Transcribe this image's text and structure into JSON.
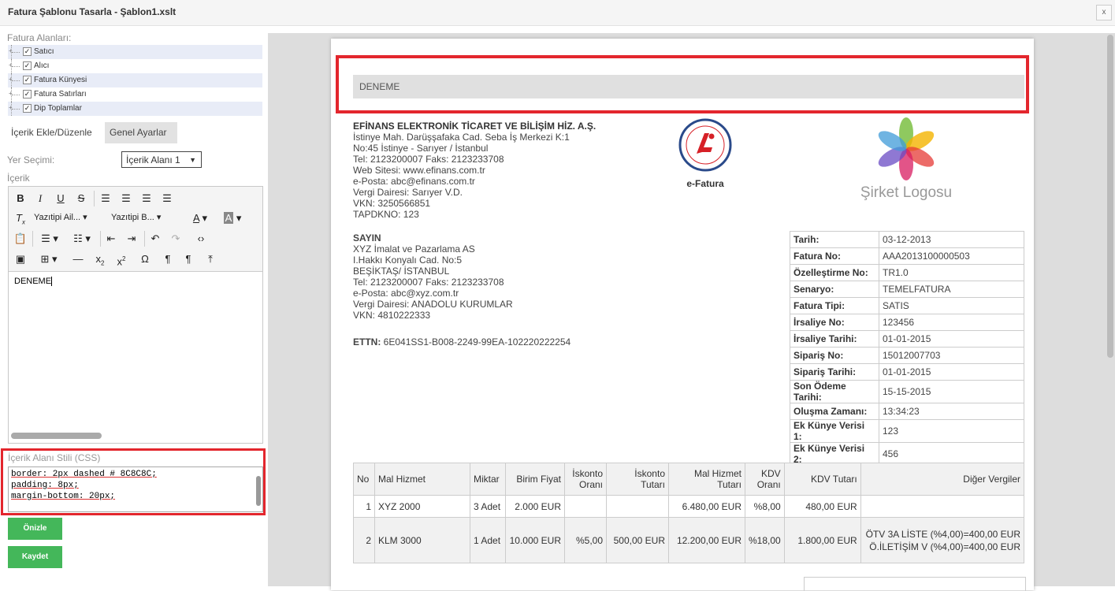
{
  "window": {
    "title": "Fatura Şablonu Tasarla - Şablon1.xslt",
    "close_label": "x"
  },
  "left": {
    "fields_label": "Fatura Alanları:",
    "tree": [
      "Satıcı",
      "Alıcı",
      "Fatura Künyesi",
      "Fatura Satırları",
      "Dip Toplamlar"
    ],
    "tabs": [
      "İçerik Ekle/Düzenle",
      "Genel Ayarlar"
    ],
    "location_label": "Yer Seçimi:",
    "location_value": "İçerik Alanı 1",
    "content_label": "İçerik",
    "font_family_dd": "Yazıtipi Ail...",
    "font_size_dd": "Yazıtipi B...",
    "editor_text": "DENEME",
    "css_label": "İçerik Alanı Stili (CSS)",
    "css_lines": [
      "border: 2px dashed # 8C8C8C;",
      "padding: 8px;",
      "margin-bottom: 20px;"
    ],
    "preview_btn": "Önizle",
    "save_btn": "Kaydet"
  },
  "invoice": {
    "header_text": "DENEME",
    "seller": {
      "name": "EFİNANS ELEKTRONİK TİCARET VE BİLİŞİM HİZ. A.Ş.",
      "lines": [
        "İstinye Mah. Darüşşafaka Cad. Seba İş Merkezi K:1",
        "No:45 İstinye - Sarıyer / İstanbul",
        "Tel: 2123200007 Faks: 2123233708",
        "Web Sitesi: www.efinans.com.tr",
        "e-Posta: abc@efinans.com.tr",
        "Vergi Dairesi: Sarıyer V.D.",
        "VKN: 3250566851",
        "TAPDKNO: 123"
      ]
    },
    "efatura_label": "e-Fatura",
    "company_logo": "Şirket Logosu",
    "buyer": {
      "title": "SAYIN",
      "lines": [
        "XYZ İmalat ve Pazarlama AS",
        "I.Hakkı Konyalı Cad.  No:5",
        "BEŞİKTAŞ/ İSTANBUL",
        "Tel: 2123200007 Faks: 2123233708",
        "e-Posta: abc@xyz.com.tr",
        "Vergi Dairesi: ANADOLU KURUMLAR",
        "VKN: 4810222333"
      ]
    },
    "ettn_label": "ETTN:",
    "ettn_value": "6E041SS1-B008-2249-99EA-102220222254",
    "info": [
      [
        "Tarih:",
        "03-12-2013"
      ],
      [
        "Fatura No:",
        "AAA2013100000503"
      ],
      [
        "Özelleştirme No:",
        "TR1.0"
      ],
      [
        "Senaryo:",
        "TEMELFATURA"
      ],
      [
        "Fatura Tipi:",
        "SATIS"
      ],
      [
        "İrsaliye No:",
        "123456"
      ],
      [
        "İrsaliye Tarihi:",
        "01-01-2015"
      ],
      [
        "Sipariş No:",
        "15012007703"
      ],
      [
        "Sipariş Tarihi:",
        "01-01-2015"
      ],
      [
        "Son Ödeme Tarihi:",
        "15-15-2015"
      ],
      [
        "Oluşma Zamanı:",
        "13:34:23"
      ],
      [
        "Ek Künye Verisi 1:",
        "123"
      ],
      [
        "Ek Künye Verisi 2:",
        "456"
      ]
    ],
    "items_headers": [
      "No",
      "Mal Hizmet",
      "Miktar",
      "Birim Fiyat",
      "İskonto Oranı",
      "İskonto Tutarı",
      "Mal Hizmet Tutarı",
      "KDV Oranı",
      "KDV Tutarı",
      "Diğer Vergiler"
    ],
    "items": [
      {
        "no": "1",
        "name": "XYZ 2000",
        "qty": "3 Adet",
        "price": "2.000 EUR",
        "disc_rate": "",
        "disc_amt": "",
        "amount": "6.480,00 EUR",
        "vat_rate": "%8,00",
        "vat_amt": "480,00 EUR",
        "other1": "",
        "other2": ""
      },
      {
        "no": "2",
        "name": "KLM 3000",
        "qty": "1 Adet",
        "price": "10.000 EUR",
        "disc_rate": "%5,00",
        "disc_amt": "500,00 EUR",
        "amount": "12.200,00 EUR",
        "vat_rate": "%18,00",
        "vat_amt": "1.800,00 EUR",
        "other1": "ÖTV 3A LİSTE (%4,00)=400,00 EUR",
        "other2": "Ö.İLETİŞİM V (%4,00)=400,00 EUR"
      }
    ]
  }
}
